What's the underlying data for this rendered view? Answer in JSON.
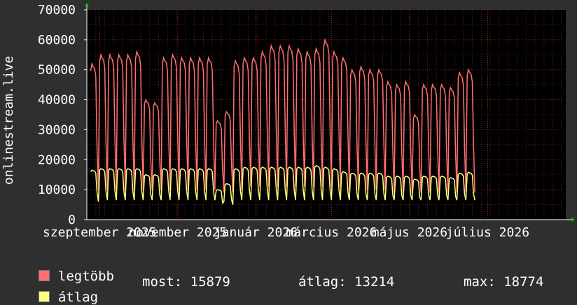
{
  "chart_data": {
    "type": "line",
    "ylabel": "onlinestream.live",
    "ylim": [
      0,
      70000
    ],
    "yticks": [
      "0",
      "10000",
      "20000",
      "30000",
      "40000",
      "50000",
      "60000",
      "70000"
    ],
    "ytick_values": [
      0,
      10000,
      20000,
      30000,
      40000,
      50000,
      60000,
      70000
    ],
    "x_range": [
      "2025-08-22",
      "2026-08-31"
    ],
    "xtick_labels": [
      "szeptember 2025",
      "november 2025",
      "január 2026",
      "március 2026",
      "május 2026",
      "július 2026"
    ],
    "xtick_dates": [
      "2025-09-01",
      "2025-11-01",
      "2026-01-01",
      "2026-03-01",
      "2026-05-01",
      "2026-07-01"
    ],
    "grid": true,
    "legend_position": "bottom-left",
    "series": [
      {
        "name": "legtöbb",
        "color": "#ff7070",
        "weekly_peaks": [
          52000,
          55000,
          55000,
          55000,
          55000,
          56000,
          40000,
          39000,
          54000,
          55000,
          54000,
          54000,
          54000,
          54000,
          33000,
          36000,
          53000,
          54000,
          54000,
          56000,
          58000,
          58000,
          58000,
          57000,
          56000,
          57000,
          60000,
          56000,
          54000,
          50000,
          51000,
          50000,
          50000,
          46000,
          45000,
          46000,
          35000,
          45000,
          45000,
          45000,
          44000,
          49000,
          50000
        ],
        "weekday_lows": [
          40000,
          43000,
          44000,
          45000,
          44000,
          44000,
          33000,
          32000,
          44000,
          44000,
          43000,
          43000,
          43000,
          43000,
          28000,
          30000,
          43000,
          44000,
          44000,
          45000,
          47000,
          47000,
          47000,
          46000,
          45000,
          46000,
          48000,
          45000,
          44000,
          41000,
          42000,
          41000,
          41000,
          37000,
          36000,
          37000,
          29000,
          37000,
          37000,
          37000,
          36000,
          40000,
          41000
        ],
        "weekend_lows": [
          10000,
          10000,
          10000,
          10000,
          10000,
          10000,
          10000,
          10000,
          10000,
          10000,
          10000,
          10000,
          10000,
          10000,
          9000,
          9000,
          10000,
          11000,
          11000,
          11000,
          11000,
          11000,
          11000,
          11000,
          11000,
          11000,
          11000,
          11000,
          10000,
          10000,
          10000,
          10000,
          10000,
          9000,
          9000,
          9000,
          9000,
          9000,
          9000,
          9000,
          9000,
          9000,
          9000
        ]
      },
      {
        "name": "átlag",
        "color": "#ffff80",
        "weekly_peaks": [
          16500,
          17000,
          17000,
          17000,
          17000,
          17000,
          15000,
          15000,
          17000,
          17000,
          17000,
          17000,
          17000,
          17000,
          10000,
          12000,
          17000,
          17500,
          17500,
          17500,
          17500,
          17500,
          17500,
          17500,
          17500,
          18000,
          17500,
          17000,
          16000,
          15500,
          15500,
          15500,
          15500,
          14500,
          14500,
          14500,
          13500,
          14500,
          14500,
          14500,
          14000,
          15500,
          15800
        ],
        "weekend_lows": [
          6000,
          6500,
          6500,
          6500,
          6500,
          6500,
          6500,
          6500,
          6500,
          6500,
          6500,
          6500,
          6500,
          6500,
          6000,
          5000,
          6500,
          6500,
          6500,
          6500,
          6500,
          6500,
          6500,
          6500,
          6500,
          6500,
          6500,
          6500,
          6500,
          6500,
          6500,
          6500,
          6500,
          6500,
          6500,
          6500,
          6500,
          6500,
          6500,
          6500,
          6500,
          6500,
          6500
        ]
      }
    ]
  },
  "legend": {
    "items": [
      {
        "label": "legtöbb",
        "color": "#ff7070"
      },
      {
        "label": "átlag",
        "color": "#ffff80"
      }
    ]
  },
  "stats": {
    "most": "most: 15879",
    "atlag": "átlag: 13214",
    "max": "max: 18774"
  },
  "colors": {
    "background": "#2f2f2f",
    "plot_background": "#000000",
    "grid": "#ff3030",
    "axis": "#ffffff",
    "arrow": "#00cc00"
  }
}
